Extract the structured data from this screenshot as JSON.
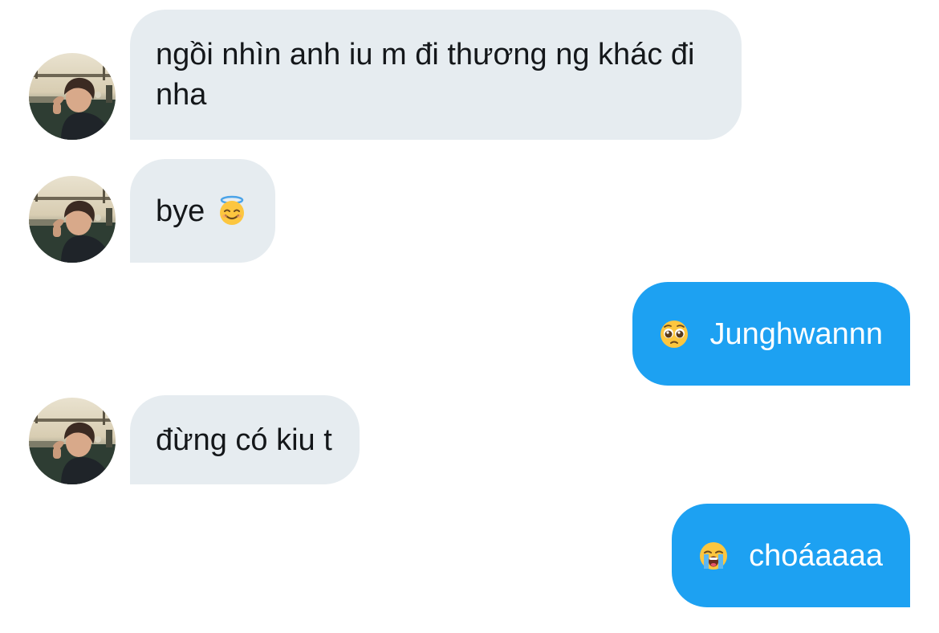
{
  "conversation": {
    "messages": [
      {
        "direction": "incoming",
        "text": "ngồi nhìn anh iu m đi thương ng khác đi nha"
      },
      {
        "direction": "incoming",
        "text": "bye",
        "emoji": "smiling-face-with-halo-icon"
      },
      {
        "direction": "outgoing",
        "text": "Junghwannn",
        "emoji": "pleading-face-icon"
      },
      {
        "direction": "incoming",
        "text": "đừng có kiu t"
      },
      {
        "direction": "outgoing",
        "text": "choáaaaa",
        "emoji": "loudly-crying-face-icon"
      }
    ]
  },
  "colors": {
    "incoming_bubble": "#e6ecf0",
    "outgoing_bubble": "#1da1f2",
    "incoming_text": "#14171a",
    "outgoing_text": "#ffffff"
  }
}
